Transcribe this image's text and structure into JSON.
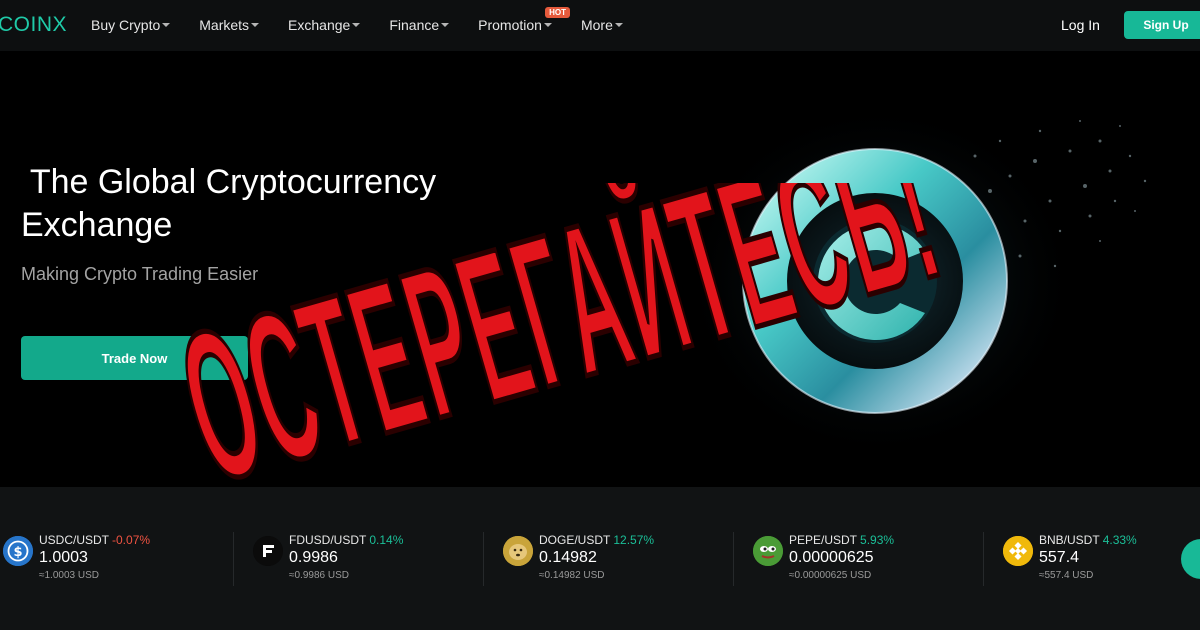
{
  "nav": {
    "logo": "COINX",
    "items": [
      {
        "label": "Buy Crypto"
      },
      {
        "label": "Markets"
      },
      {
        "label": "Exchange"
      },
      {
        "label": "Finance"
      },
      {
        "label": "Promotion",
        "badge": "HOT"
      },
      {
        "label": "More"
      }
    ],
    "login": "Log In",
    "signup": "Sign Up"
  },
  "hero": {
    "title_line1": " The Global Cryptocurrency",
    "title_line2": "Exchange",
    "subtitle": "Making Crypto Trading Easier",
    "cta": "Trade Now",
    "warning_text": "ОСТЕРЕГАЙТЕСЬ!"
  },
  "ticker": [
    {
      "pair": "USDC/USDT",
      "change": "-0.07%",
      "direction": "down",
      "price": "1.0003",
      "usd": "≈1.0003 USD",
      "icon": "usdc-icon"
    },
    {
      "pair": "FDUSD/USDT",
      "change": "0.14%",
      "direction": "up",
      "price": "0.9986",
      "usd": "≈0.9986 USD",
      "icon": "fdusd-icon"
    },
    {
      "pair": "DOGE/USDT",
      "change": "12.57%",
      "direction": "up",
      "price": "0.14982",
      "usd": "≈0.14982 USD",
      "icon": "doge-icon"
    },
    {
      "pair": "PEPE/USDT",
      "change": "5.93%",
      "direction": "up",
      "price": "0.00000625",
      "usd": "≈0.00000625 USD",
      "icon": "pepe-icon"
    },
    {
      "pair": "BNB/USDT",
      "change": "4.33%",
      "direction": "up",
      "price": "557.4",
      "usd": "≈557.4 USD",
      "icon": "bnb-icon"
    }
  ],
  "colors": {
    "accent": "#17b897",
    "up": "#1bbf98",
    "down": "#f05342",
    "warning": "#e2141b"
  }
}
